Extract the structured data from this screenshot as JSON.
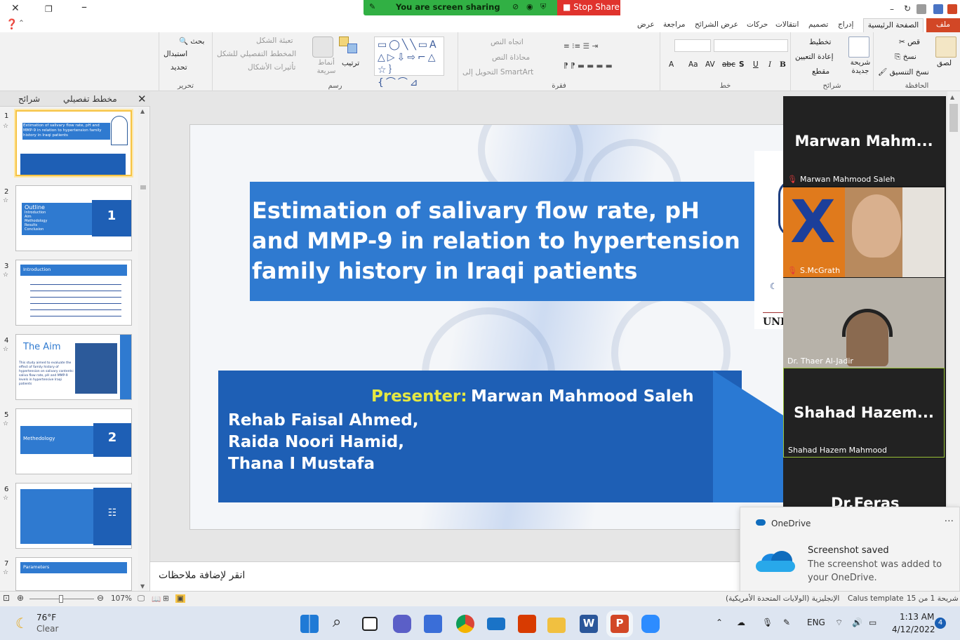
{
  "screen_share": {
    "status": "You are screen sharing",
    "stop_label": "Stop Share"
  },
  "ribbon_tabs": [
    "ملف",
    "الصفحة الرئيسية",
    "إدراج",
    "تصميم",
    "انتقالات",
    "حركات",
    "عرض الشرائح",
    "مراجعة",
    "عرض"
  ],
  "ribbon": {
    "clipboard": {
      "label": "الحافظة",
      "paste": "لصق",
      "cut": "قص",
      "copy": "نسخ",
      "format_painter": "نسخ التنسيق"
    },
    "slides": {
      "label": "شرائح",
      "new_slide": "شريحة جديدة",
      "layout": "تخطيط",
      "reset": "إعادة التعيين",
      "section": "مقطع"
    },
    "font": {
      "label": "خط",
      "bold": "B",
      "italic": "I",
      "underline": "U",
      "shadow": "S",
      "strike": "abc",
      "spacing": "AV",
      "case": "Aa"
    },
    "paragraph": {
      "label": "فقرة",
      "text_direction": "اتجاه النص",
      "align_text": "محاذاة النص",
      "smartart": "التحويل إلى SmartArt"
    },
    "drawing": {
      "label": "رسم",
      "arrange": "ترتيب",
      "quick_styles": "أنماط سريعة",
      "shape_fill": "تعبئة الشكل",
      "shape_outline": "المخطط التفصيلي للشكل",
      "shape_effects": "تأثيرات الأشكال"
    },
    "editing": {
      "label": "تحرير",
      "find": "بحث",
      "replace": "استبدال",
      "select": "تحديد"
    }
  },
  "left_panel": {
    "tab_outline": "مخطط تفصيلي",
    "tab_slides": "شرائح",
    "thumbs": [
      {
        "num": "1",
        "title": "Estimation of salivary flow rate, pH and MMP-9 in relation to hypertension family history in Iraqi patients"
      },
      {
        "num": "2",
        "title": "Outline",
        "badge": "1",
        "items": [
          "Introduction",
          "Aim",
          "Methodology",
          "Results",
          "Conclusion"
        ]
      },
      {
        "num": "3",
        "title": "Introduction"
      },
      {
        "num": "4",
        "title": "The Aim",
        "body": "This study aimed to evaluate the effect of family history of hypertension on salivary contents: saliva flow rate, pH and MMP-9 levels in hypertensive Iraqi patients"
      },
      {
        "num": "5",
        "title": "Methedology",
        "badge": "2"
      },
      {
        "num": "6",
        "title": ""
      },
      {
        "num": "7",
        "title": "Parameters"
      }
    ]
  },
  "slide": {
    "title": "Estimation of salivary flow rate, pH and MMP-9 in relation to hypertension family history in Iraqi patients",
    "presenter_label": "Presenter:",
    "presenter_name": "Marwan Mahmood Saleh",
    "authors": [
      "Rehab Faisal Ahmed,",
      "Raida Noori Hamid,",
      "Thana I Mustafa"
    ],
    "logo_text": "UNI"
  },
  "notes_placeholder": "انقر لإضافة ملاحظات",
  "participants": [
    {
      "big": "Marwan  Mahm...",
      "label": "Marwan Mahmood Saleh",
      "muted": true
    },
    {
      "big": "",
      "label": "S.McGrath",
      "muted": true
    },
    {
      "big": "",
      "label": "Dr. Thaer Al-Jadir",
      "muted": false
    },
    {
      "big": "Shahad  Hazem...",
      "label": "Shahad Hazem Mahmood",
      "muted": false
    },
    {
      "big": "Dr.Feras",
      "label": "",
      "muted": false
    }
  ],
  "toast": {
    "app": "OneDrive",
    "title": "Screenshot saved",
    "body": "The screenshot was added to your OneDrive.",
    "more": "···"
  },
  "status_bar": {
    "zoom": "107%",
    "slide_info": "شريحة 1 من 15",
    "theme": "Calus template",
    "language": "الإنجليزية (الولايات المتحدة الأمريكية)"
  },
  "taskbar": {
    "weather_temp": "76°F",
    "weather_desc": "Clear",
    "language": "ENG",
    "time": "1:13 AM",
    "date": "4/12/2022",
    "notifications": "4"
  },
  "colors": {
    "accent_blue": "#2f7ad0",
    "dark_blue": "#1e5fb5",
    "presenter_yellow": "#e5e842",
    "share_green": "#31b044",
    "stop_red": "#e0332d",
    "file_tab": "#d24726"
  }
}
